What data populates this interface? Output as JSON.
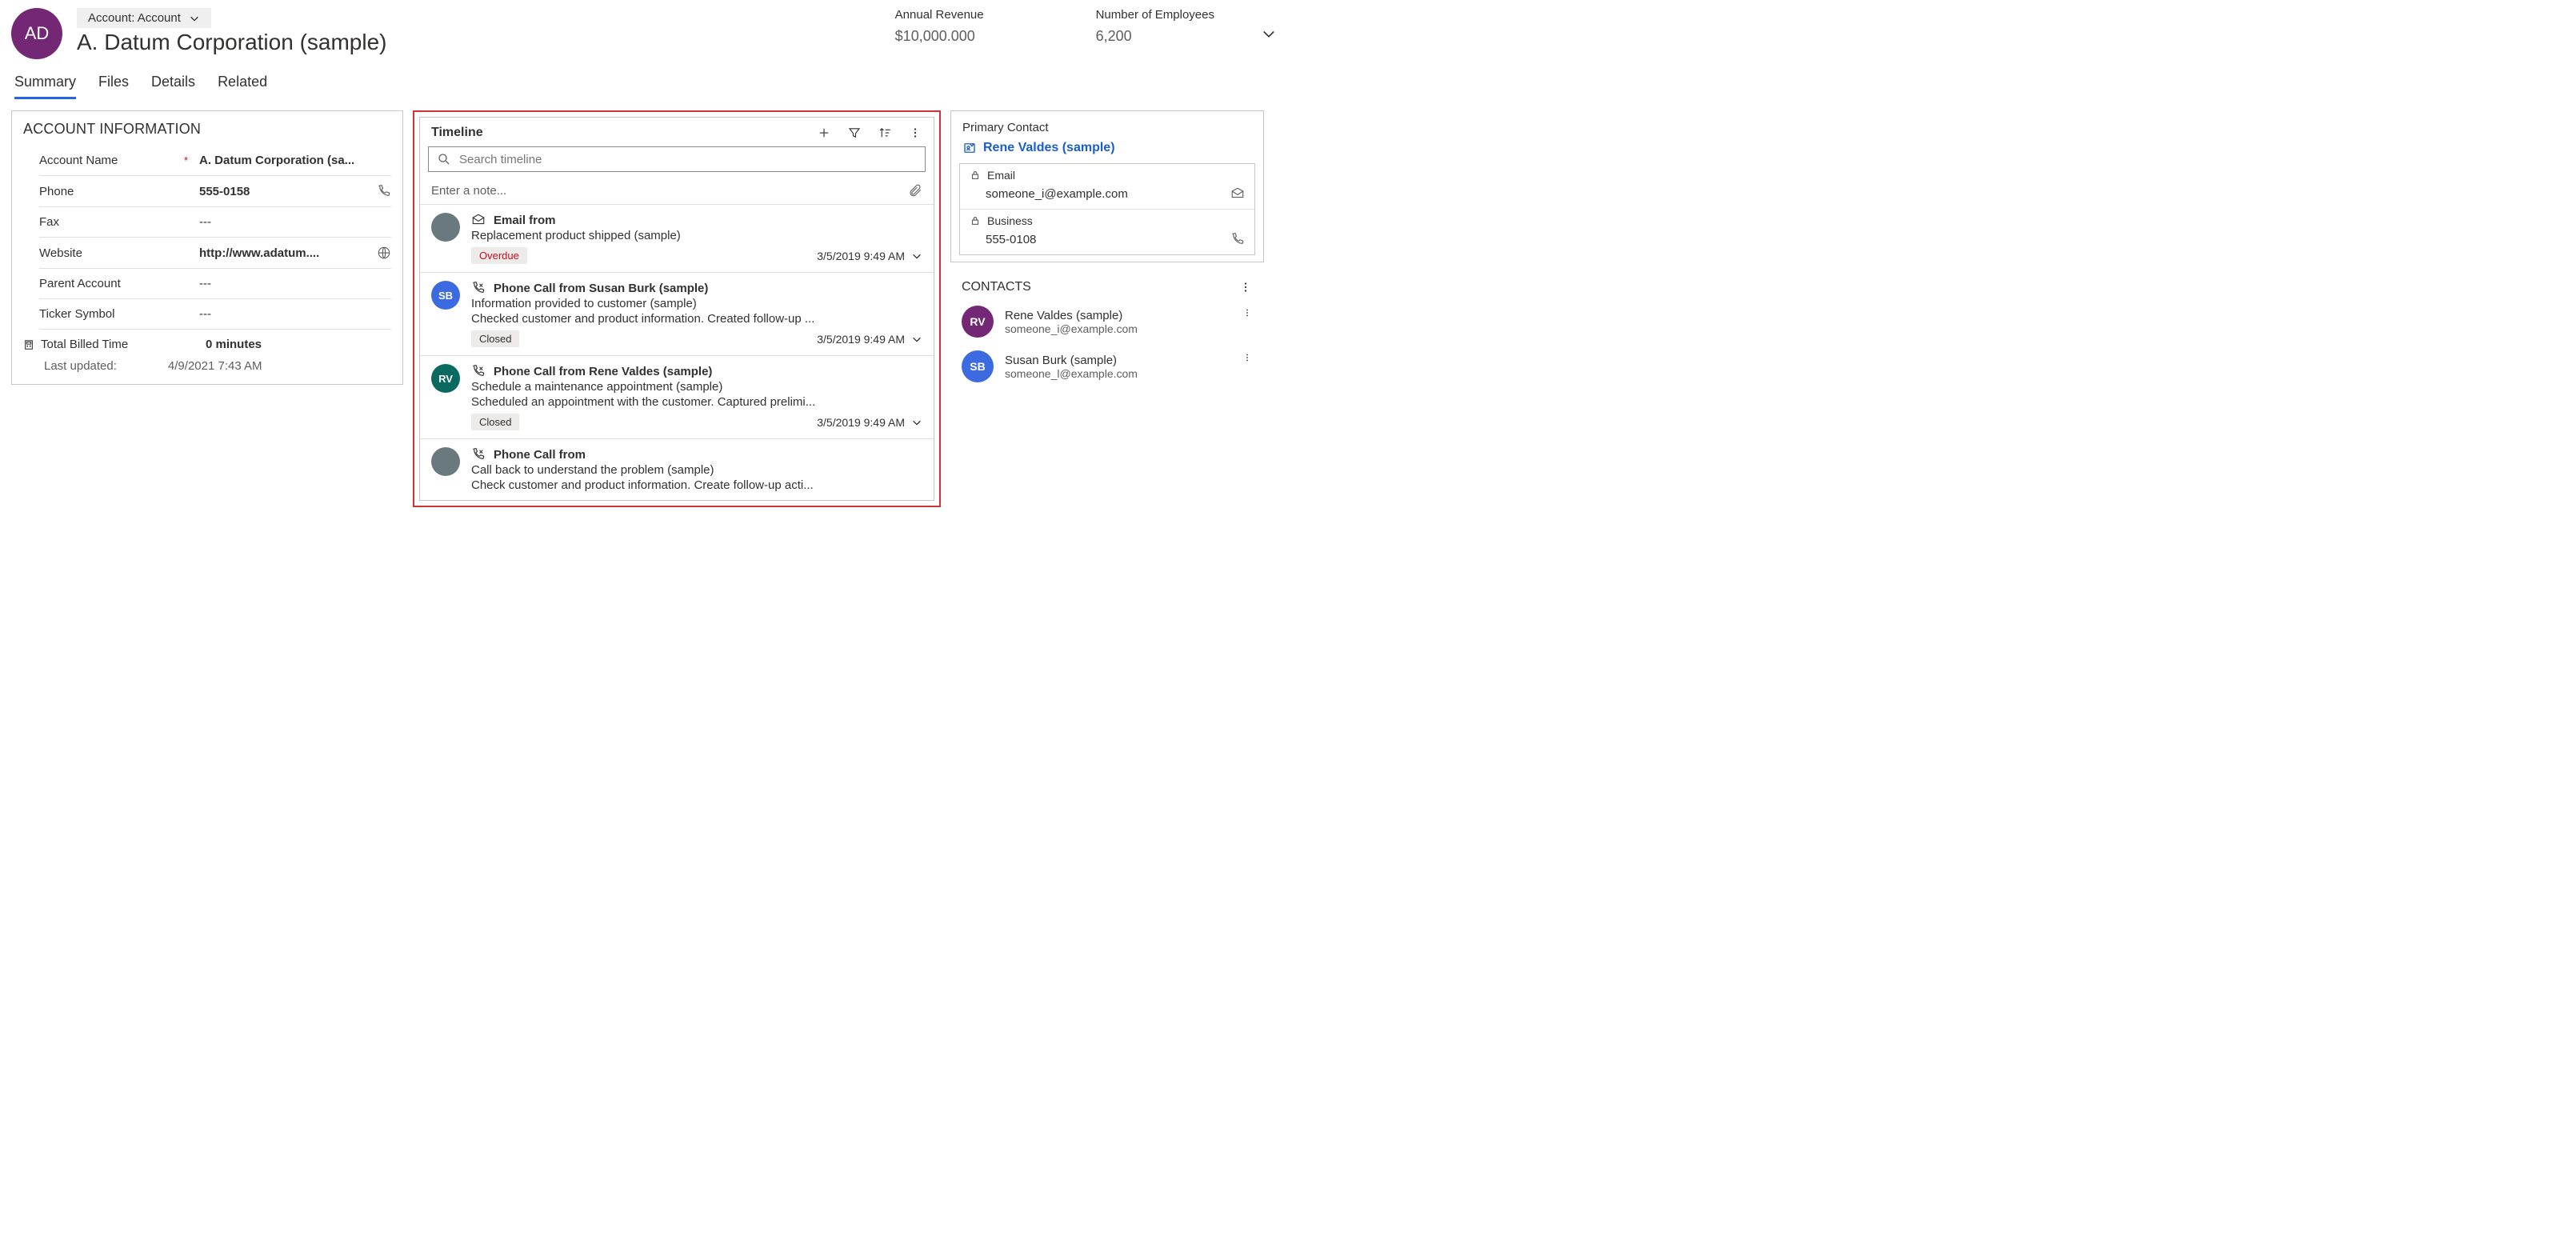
{
  "header": {
    "avatar_initials": "AD",
    "form_switcher": "Account: Account",
    "title": "A. Datum Corporation (sample)",
    "metrics": [
      {
        "label": "Annual Revenue",
        "value": "$10,000.000"
      },
      {
        "label": "Number of Employees",
        "value": "6,200"
      }
    ]
  },
  "tabs": [
    "Summary",
    "Files",
    "Details",
    "Related"
  ],
  "active_tab": "Summary",
  "account_info": {
    "title": "ACCOUNT INFORMATION",
    "fields": {
      "account_name": {
        "label": "Account Name",
        "value": "A. Datum Corporation (sa...",
        "required": true
      },
      "phone": {
        "label": "Phone",
        "value": "555-0158"
      },
      "fax": {
        "label": "Fax",
        "value": "---"
      },
      "website": {
        "label": "Website",
        "value": "http://www.adatum...."
      },
      "parent_account": {
        "label": "Parent Account",
        "value": "---"
      },
      "ticker_symbol": {
        "label": "Ticker Symbol",
        "value": "---"
      }
    },
    "billed": {
      "label": "Total Billed Time",
      "value": "0 minutes"
    },
    "last_updated": {
      "label": "Last updated:",
      "value": "4/9/2021 7:43 AM"
    }
  },
  "timeline": {
    "title": "Timeline",
    "search_placeholder": "Search timeline",
    "note_placeholder": "Enter a note...",
    "items": [
      {
        "avatar": {
          "initials": "",
          "color": "grey"
        },
        "type_label": "Email from",
        "icon": "email",
        "subject": "Replacement product shipped (sample)",
        "description": "",
        "status": "Overdue",
        "status_kind": "overdue",
        "date": "3/5/2019 9:49 AM"
      },
      {
        "avatar": {
          "initials": "SB",
          "color": "blue"
        },
        "type_label": "Phone Call from Susan Burk (sample)",
        "icon": "phone",
        "subject": "Information provided to customer (sample)",
        "description": "Checked customer and product information. Created follow-up ...",
        "status": "Closed",
        "status_kind": "closed",
        "date": "3/5/2019 9:49 AM"
      },
      {
        "avatar": {
          "initials": "RV",
          "color": "teal"
        },
        "type_label": "Phone Call from Rene Valdes (sample)",
        "icon": "phone",
        "subject": "Schedule a maintenance appointment (sample)",
        "description": "Scheduled an appointment with the customer. Captured prelimi...",
        "status": "Closed",
        "status_kind": "closed",
        "date": "3/5/2019 9:49 AM"
      },
      {
        "avatar": {
          "initials": "",
          "color": "grey"
        },
        "type_label": "Phone Call from",
        "icon": "phone",
        "subject": "Call back to understand the problem (sample)",
        "description": "Check customer and product information. Create follow-up acti...",
        "status": "",
        "status_kind": "",
        "date": ""
      }
    ]
  },
  "primary_contact": {
    "title": "Primary Contact",
    "name": "Rene Valdes (sample)",
    "email": {
      "label": "Email",
      "value": "someone_i@example.com"
    },
    "business": {
      "label": "Business",
      "value": "555-0108"
    }
  },
  "contacts": {
    "title": "CONTACTS",
    "items": [
      {
        "initials": "RV",
        "color": "purple",
        "name": "Rene Valdes (sample)",
        "email": "someone_i@example.com"
      },
      {
        "initials": "SB",
        "color": "blue",
        "name": "Susan Burk (sample)",
        "email": "someone_l@example.com"
      }
    ]
  }
}
